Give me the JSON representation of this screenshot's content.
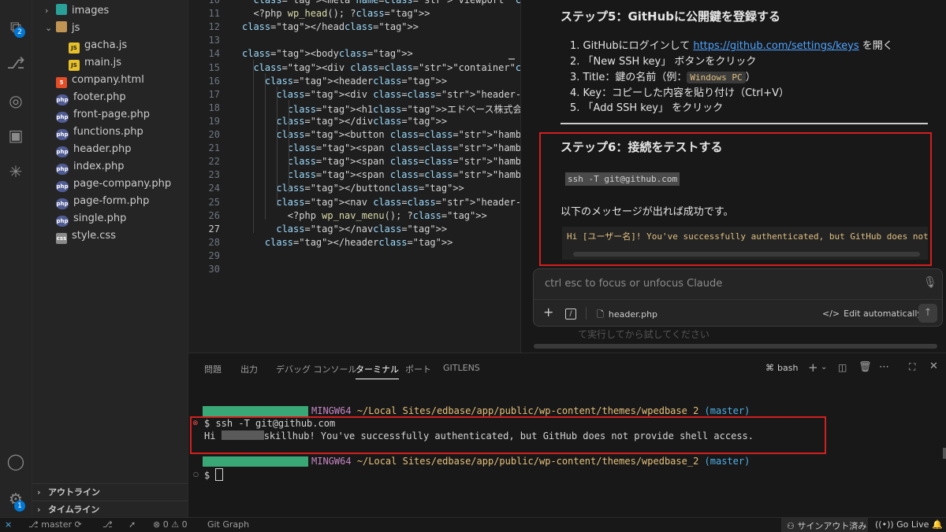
{
  "activity": {
    "extensions_badge": "2",
    "settings_badge": "1"
  },
  "explorer": {
    "files": [
      {
        "name": "images",
        "type": "folder-img",
        "indent": 1,
        "chev": "›"
      },
      {
        "name": "js",
        "type": "folder",
        "indent": 1,
        "chev": "⌄"
      },
      {
        "name": "gacha.js",
        "type": "js",
        "indent": 2
      },
      {
        "name": "main.js",
        "type": "js",
        "indent": 2
      },
      {
        "name": "company.html",
        "type": "html",
        "indent": 1
      },
      {
        "name": "footer.php",
        "type": "php",
        "indent": 1
      },
      {
        "name": "front-page.php",
        "type": "php",
        "indent": 1
      },
      {
        "name": "functions.php",
        "type": "php",
        "indent": 1
      },
      {
        "name": "header.php",
        "type": "php",
        "indent": 1
      },
      {
        "name": "index.php",
        "type": "php",
        "indent": 1
      },
      {
        "name": "page-company.php",
        "type": "php",
        "indent": 1
      },
      {
        "name": "page-form.php",
        "type": "php",
        "indent": 1
      },
      {
        "name": "single.php",
        "type": "php",
        "indent": 1
      },
      {
        "name": "style.css",
        "type": "css",
        "indent": 1
      }
    ],
    "outline_label": "アウトライン",
    "timeline_label": "タイムライン"
  },
  "editor": {
    "line_numbers": [
      "10",
      "11",
      "12",
      "13",
      "14",
      "15",
      "16",
      "17",
      "18",
      "19",
      "20",
      "21",
      "22",
      "23",
      "24",
      "25",
      "26",
      "27",
      "28",
      "29",
      "30"
    ],
    "lines": [
      "  <meta name=\"viewport\" content=\"width=devic",
      "  <?php wp_head(); ?>",
      "</head>",
      "",
      "<body>",
      "  <div class=\"container\">",
      "    <header>",
      "      <div class=\"header-logo\">",
      "        <h1>エドベース株式会社</h1>",
      "      </div>",
      "      <button class=\"hamburger\" type=\"button",
      "        <span class=\"hamburger-bar\"></span>",
      "        <span class=\"hamburger-bar\"></span>",
      "        <span class=\"hamburger-bar\"></span>",
      "      </button>",
      "      <nav class=\"header-nav\" id=\"header-nav",
      "        <?php wp_nav_menu(); ?>",
      "      </nav>",
      "    </header>",
      "",
      ""
    ]
  },
  "doc": {
    "step5_title": "ステップ5：GitHubに公開鍵を登録する",
    "step5_items": {
      "i1_pre": "1. GitHubにログインして ",
      "i1_link": "https://github.com/settings/keys",
      "i1_post": " を開く",
      "i2": "2. 「New SSH key」 ボタンをクリック",
      "i3_pre": "3. Title：鍵の名前（例：",
      "i3_chip": "Windows PC",
      "i3_post": "）",
      "i4": "4. Key：コピーした内容を貼り付け（Ctrl+V）",
      "i5": "5. 「Add SSH key」 をクリック"
    },
    "step6_title": "ステップ6：接続をテストする",
    "step6_cmd": "ssh -T git@github.com",
    "step6_msg": "以下のメッセージが出れば成功です。",
    "step6_output": "Hi [ユーザー名]! You've successfully authenticated, but GitHub does not provide",
    "behind_text": "て実行してから試してください"
  },
  "claude": {
    "placeholder": "ctrl esc to focus or unfocus Claude",
    "file": "header.php",
    "edit_mode": "Edit automatically"
  },
  "panel": {
    "tabs": [
      "問題",
      "出力",
      "デバッグ コンソール",
      "ターミナル",
      "ポート",
      "GITLENS"
    ],
    "active_tab": "ターミナル",
    "shell": "bash",
    "term": {
      "env": "MINGW64",
      "path1": "~/Local Sites/edbase/app/public/wp-content/themes/wpedbase 2",
      "path2": "~/Local Sites/edbase/app/public/wp-content/themes/wpedbase_2",
      "branch": "(master)",
      "cmd": "$ ssh -T git@github.com",
      "out_pre": "Hi ",
      "out_post": "skillhub! You've successfully authenticated, but GitHub does not provide shell access.",
      "prompt": "$ "
    }
  },
  "status": {
    "branch": "master",
    "errors": "0",
    "warnings": "0",
    "git_graph": "Git Graph",
    "signout": "サインアウト済み",
    "golive": "Go Live"
  }
}
